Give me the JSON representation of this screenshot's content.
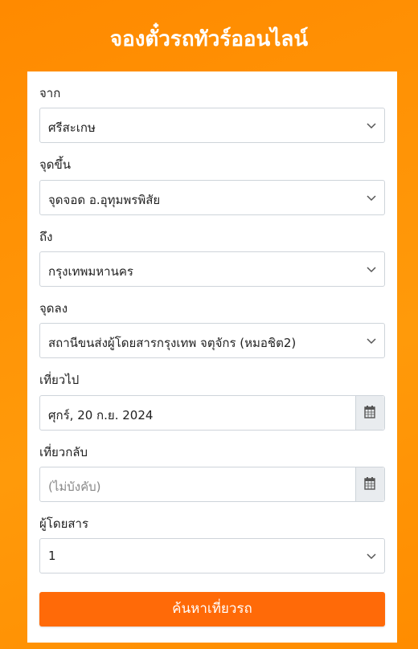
{
  "header": {
    "title": "จองตั๋วรถทัวร์ออนไลน์"
  },
  "form": {
    "from": {
      "label": "จาก",
      "value": "ศรีสะเกษ"
    },
    "pickup": {
      "label": "จุดขึ้น",
      "value": "จุดจอด อ.อุทุมพรพิสัย"
    },
    "to": {
      "label": "ถึง",
      "value": "กรุงเทพมหานคร"
    },
    "dropoff": {
      "label": "จุดลง",
      "value": "สถานีขนส่งผู้โดยสารกรุงเทพ จตุจักร (หมอชิต2)"
    },
    "depart": {
      "label": "เที่ยวไป",
      "value": "ศุกร์, 20 ก.ย. 2024"
    },
    "return": {
      "label": "เที่ยวกลับ",
      "placeholder": "(ไม่บังคับ)"
    },
    "passengers": {
      "label": "ผู้โดยสาร",
      "value": "1"
    },
    "search_button": "ค้นหาเที่ยวรถ"
  },
  "colors": {
    "accent": "#ff6a08",
    "background": "#ff9000"
  }
}
